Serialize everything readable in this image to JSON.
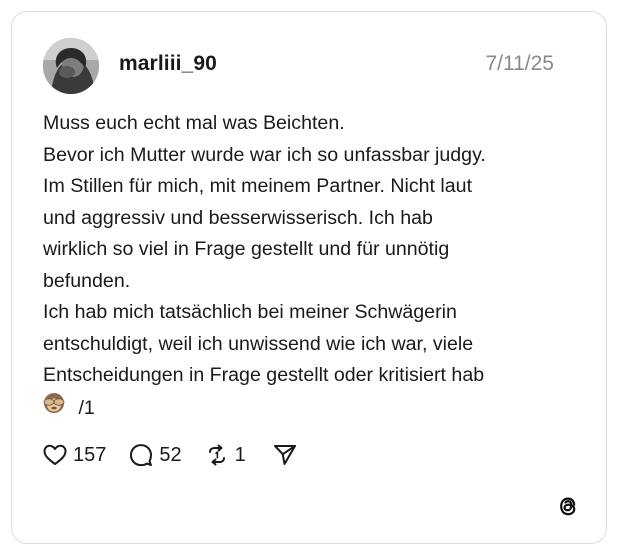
{
  "post": {
    "username": "marliii_90",
    "date": "7/11/25",
    "avatar_icon": "user-avatar",
    "text_lines": [
      "Muss euch echt mal was Beichten.",
      "Bevor ich Mutter wurde war ich so unfassbar judgy.",
      "Im Stillen für mich, mit meinem Partner. Nicht laut",
      "und aggressiv und besserwisserisch. Ich hab",
      "wirklich so viel in Frage gestellt und für unnötig",
      "befunden.",
      "Ich hab mich tatsächlich bei meiner Schwägerin",
      "entschuldigt, weil ich unwissend wie ich war, viele",
      "Entscheidungen in Frage gestellt oder kritisiert hab"
    ],
    "last_line_emoji": "see-no-evil-monkey-emoji",
    "last_line_text": "/1"
  },
  "actions": {
    "likes": "157",
    "replies": "52",
    "reposts": "1",
    "like_icon": "heart-icon",
    "reply_icon": "comment-bubble-icon",
    "repost_icon": "repost-icon",
    "share_icon": "send-icon"
  },
  "brand": {
    "logo": "threads-logo-icon"
  },
  "colors": {
    "text": "#1a1a1a",
    "muted": "#8a8a8a",
    "border": "#dcdcdc",
    "background": "#ffffff"
  }
}
